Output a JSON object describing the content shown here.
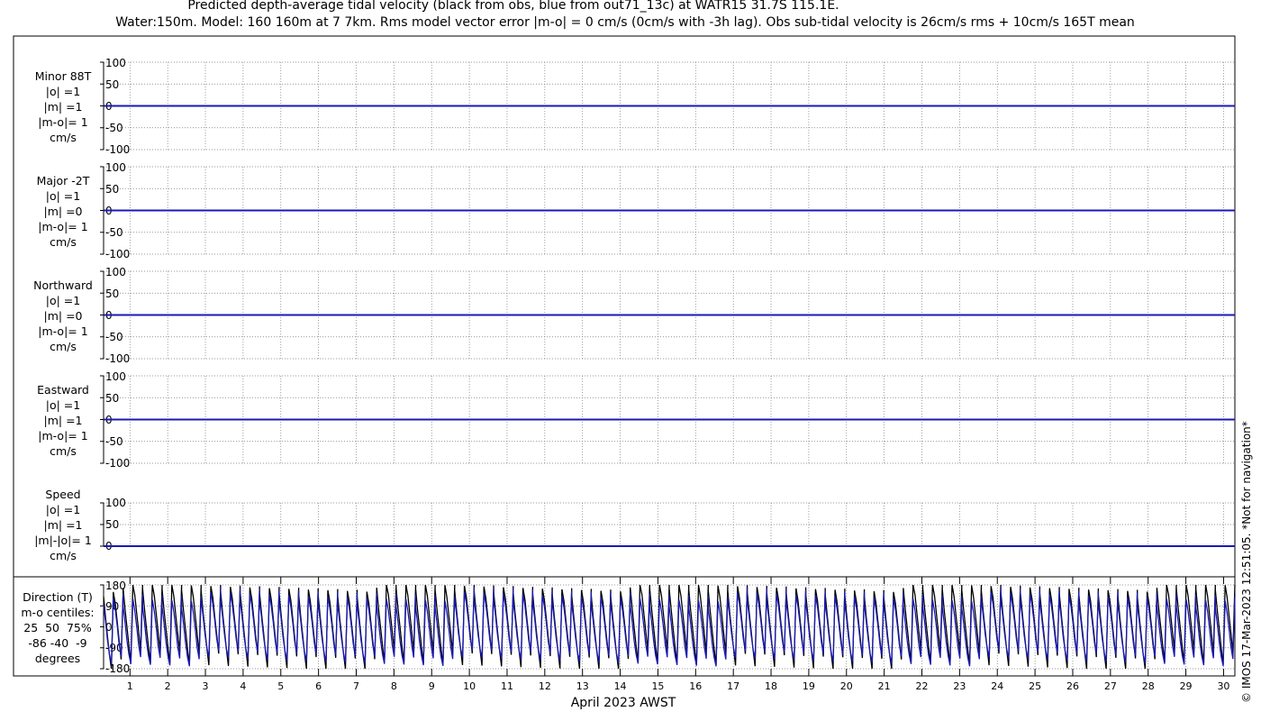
{
  "title": {
    "line1": "Predicted depth-average tidal velocity (black from obs, blue from out71_13c) at WATR15 31.7S 115.1E.",
    "line2": "Water:150m. Model: 160 160m at 7 7km. Rms model vector error |m-o| = 0 cm/s (0cm/s with -3h lag). Obs sub-tidal velocity is 26cm/s rms + 10cm/s 165T mean"
  },
  "side_note": "© IMOS 17-Mar-2023 12:51:05. *Not for navigation*",
  "colors": {
    "obs": "#000000",
    "model": "#1a1ab4",
    "grid": "#777777"
  },
  "chart_data": [
    {
      "type": "line",
      "label_lines": [
        "Minor 88T",
        "|o| =1",
        "|m| =1",
        "|m-o|= 1",
        "cm/s"
      ],
      "y_ticks": [
        "100",
        "50",
        "0",
        "-50",
        "-100"
      ],
      "ylim": [
        -100,
        100
      ],
      "series": [
        {
          "values": [
            0,
            0,
            0,
            0,
            0
          ]
        },
        {
          "values": [
            0,
            0,
            0,
            0,
            0
          ]
        }
      ]
    },
    {
      "type": "line",
      "label_lines": [
        "Major -2T",
        "|o| =1",
        "|m| =0",
        "|m-o|= 1",
        "cm/s"
      ],
      "y_ticks": [
        "100",
        "50",
        "0",
        "-50",
        "-100"
      ],
      "ylim": [
        -100,
        100
      ],
      "series": [
        {
          "values": [
            0,
            0,
            0,
            0,
            0
          ]
        },
        {
          "values": [
            0,
            0,
            0,
            0,
            0
          ]
        }
      ]
    },
    {
      "type": "line",
      "label_lines": [
        "Northward",
        "|o| =1",
        "|m| =0",
        "|m-o|= 1",
        "cm/s"
      ],
      "y_ticks": [
        "100",
        "50",
        "0",
        "-50",
        "-100"
      ],
      "ylim": [
        -100,
        100
      ],
      "series": [
        {
          "values": [
            0,
            0,
            0,
            0,
            0
          ]
        },
        {
          "values": [
            0,
            0,
            0,
            0,
            0
          ]
        }
      ]
    },
    {
      "type": "line",
      "label_lines": [
        "Eastward",
        "|o| =1",
        "|m| =1",
        "|m-o|= 1",
        "cm/s"
      ],
      "y_ticks": [
        "100",
        "50",
        "0",
        "-50",
        "-100"
      ],
      "ylim": [
        -100,
        100
      ],
      "series": [
        {
          "values": [
            0,
            0,
            0,
            0,
            0
          ]
        },
        {
          "values": [
            0,
            0,
            0,
            0,
            0
          ]
        }
      ]
    },
    {
      "type": "line",
      "label_lines": [
        "Speed",
        "|o| =1",
        "|m| =1",
        "|m|-|o|= 1",
        "cm/s"
      ],
      "y_ticks": [
        "100",
        "50",
        "0"
      ],
      "ylim": [
        0,
        100
      ],
      "series": [
        {
          "values": [
            0,
            0,
            0,
            0,
            0
          ]
        },
        {
          "values": [
            0,
            0,
            0,
            0,
            0
          ]
        }
      ]
    },
    {
      "type": "line",
      "label_lines": [
        "Direction (T)",
        "m-o centiles:",
        "25  50  75%",
        "-86 -40  -9",
        "degrees"
      ],
      "y_ticks": [
        "180",
        "90",
        "0",
        "-90",
        "-180"
      ],
      "ylim": [
        -180,
        180
      ],
      "series": [
        {
          "values": [
            150,
            60,
            -20,
            -100,
            -170,
            170,
            120,
            40,
            -40,
            -120,
            175
          ]
        },
        {
          "values": [
            100,
            30,
            -50,
            -110,
            -150,
            130,
            80,
            10,
            -70,
            -120,
            150
          ]
        }
      ]
    }
  ],
  "x_axis": {
    "ticks": [
      "1",
      "2",
      "3",
      "4",
      "5",
      "6",
      "7",
      "8",
      "9",
      "10",
      "11",
      "12",
      "13",
      "14",
      "15",
      "16",
      "17",
      "18",
      "19",
      "20",
      "21",
      "22",
      "23",
      "24",
      "25",
      "26",
      "27",
      "28",
      "29",
      "30"
    ],
    "label": "April 2023 AWST",
    "xlim": [
      0.3,
      30.3
    ]
  }
}
